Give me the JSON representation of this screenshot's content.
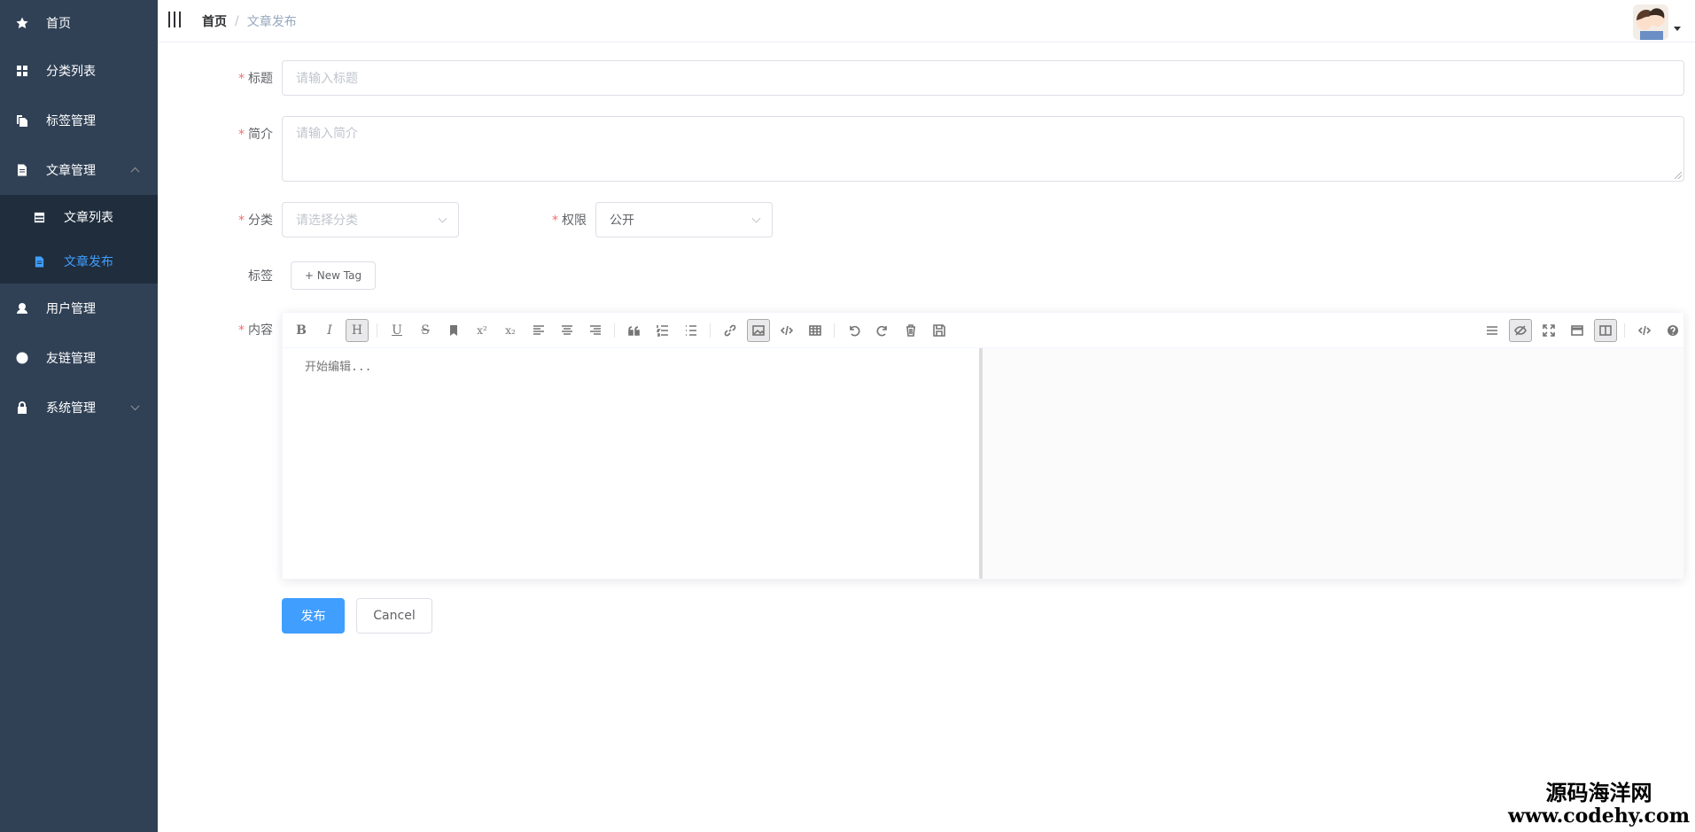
{
  "sidebar": {
    "items": [
      {
        "label": "首页",
        "icon": "star-icon"
      },
      {
        "label": "分类列表",
        "icon": "grid-icon"
      },
      {
        "label": "标签管理",
        "icon": "copy-icon"
      },
      {
        "label": "文章管理",
        "icon": "document-icon",
        "expanded": true,
        "children": [
          {
            "label": "文章列表",
            "icon": "table-icon"
          },
          {
            "label": "文章发布",
            "icon": "document-icon",
            "active": true
          }
        ]
      },
      {
        "label": "用户管理",
        "icon": "user-icon"
      },
      {
        "label": "友链管理",
        "icon": "globe-icon"
      },
      {
        "label": "系统管理",
        "icon": "lock-icon"
      }
    ],
    "active_color": "#409eff"
  },
  "navbar": {
    "breadcrumb": [
      "首页",
      "文章发布"
    ]
  },
  "form": {
    "title": {
      "label": "标题",
      "placeholder": "请输入标题"
    },
    "summary": {
      "label": "简介",
      "placeholder": "请输入简介"
    },
    "category": {
      "label": "分类",
      "placeholder": "请选择分类"
    },
    "permission": {
      "label": "权限",
      "value": "公开"
    },
    "tags": {
      "label": "标签",
      "new_tag": "+ New Tag"
    },
    "content": {
      "label": "内容",
      "placeholder": "开始编辑..."
    }
  },
  "toolbar": {
    "bold": "B",
    "italic": "I",
    "header": "H",
    "underline": "U",
    "strike": "S",
    "sup": "x²",
    "sub": "x₂"
  },
  "buttons": {
    "submit": "发布",
    "cancel": "Cancel"
  },
  "watermark": {
    "line1": "源码海洋网",
    "line2": "www.codehy.com"
  }
}
